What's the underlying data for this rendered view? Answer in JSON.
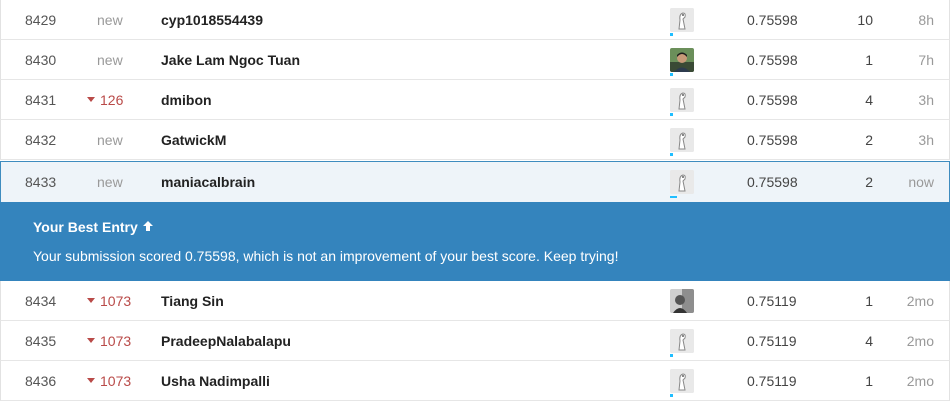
{
  "rows_before": [
    {
      "rank": "8429",
      "change": "new",
      "change_type": "new",
      "team": "cyp1018554439",
      "avatar": "goose-icon",
      "score": "0.75598",
      "entries": "10",
      "last": "8h"
    },
    {
      "rank": "8430",
      "change": "new",
      "change_type": "new",
      "team": "Jake Lam Ngoc Tuan",
      "avatar": "photo-avatar",
      "score": "0.75598",
      "entries": "1",
      "last": "7h"
    },
    {
      "rank": "8431",
      "change": "126",
      "change_type": "down",
      "team": "dmibon",
      "avatar": "goose-icon",
      "score": "0.75598",
      "entries": "4",
      "last": "3h"
    },
    {
      "rank": "8432",
      "change": "new",
      "change_type": "new",
      "team": "GatwickM",
      "avatar": "goose-icon",
      "score": "0.75598",
      "entries": "2",
      "last": "3h"
    }
  ],
  "current_row": {
    "rank": "8433",
    "change": "new",
    "change_type": "new",
    "team": "maniacalbrain",
    "avatar": "goose-icon",
    "score": "0.75598",
    "entries": "2",
    "last": "now"
  },
  "banner": {
    "title": "Your Best Entry",
    "message": "Your submission scored 0.75598, which is not an improvement of your best score. Keep trying!"
  },
  "rows_after": [
    {
      "rank": "8434",
      "change": "1073",
      "change_type": "down",
      "team": "Tiang Sin",
      "avatar": "photo-avatar",
      "score": "0.75119",
      "entries": "1",
      "last": "2mo"
    },
    {
      "rank": "8435",
      "change": "1073",
      "change_type": "down",
      "team": "PradeepNalabalapu",
      "avatar": "goose-icon",
      "score": "0.75119",
      "entries": "4",
      "last": "2mo"
    },
    {
      "rank": "8436",
      "change": "1073",
      "change_type": "down",
      "team": "Usha Nadimpalli",
      "avatar": "goose-icon",
      "score": "0.75119",
      "entries": "1",
      "last": "2mo"
    }
  ],
  "colors": {
    "banner": "#3484bd",
    "rank_drop": "#b94a48",
    "current_row_bg": "#eef4f9"
  }
}
